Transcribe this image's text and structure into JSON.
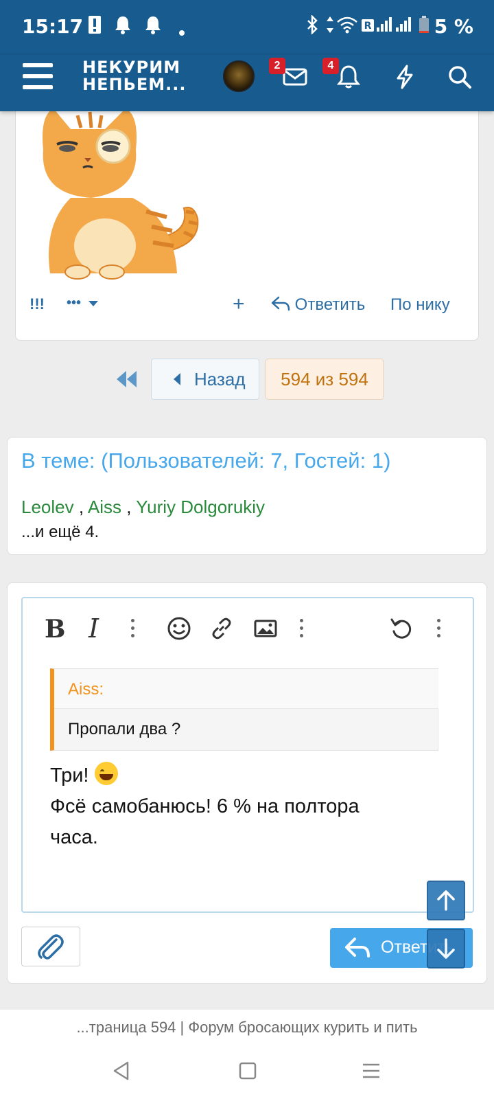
{
  "status_bar": {
    "time": "15:17",
    "battery": "5 %",
    "icons": [
      "alert-icon",
      "bell-icon",
      "bell-icon",
      "dot-icon",
      "bluetooth-icon",
      "data-arrows-icon",
      "wifi-icon",
      "roaming-icon",
      "signal-icon",
      "signal-icon",
      "battery-icon"
    ]
  },
  "header": {
    "logo_line1": "НЕКУРИМ",
    "logo_line2": "НЕПЬЕМ...",
    "messages_badge": "2",
    "alerts_badge": "4"
  },
  "post": {
    "actions": {
      "report": "!!!",
      "more": "•••",
      "add": "+",
      "reply": "Ответить",
      "by_nick": "По нику"
    }
  },
  "pagination": {
    "back": "Назад",
    "current": "594 из 594"
  },
  "online": {
    "title": "В теме: (Пользователей: 7, Гостей: 1)",
    "users": [
      "Leolev",
      "Aiss",
      "Yuriy Dolgorukiy"
    ],
    "separator": " , ",
    "more": "...и ещё 4."
  },
  "editor": {
    "quote_author": "Aiss:",
    "quote_text": "Пропали два ?",
    "message_line1": "Три! ",
    "message_line2": "Фсё самобанюсь! 6 % на полтора",
    "message_line3": "часа.",
    "reply_button": "Ответить"
  },
  "browser": {
    "title": "...траница 594 | Форум бросающих курить и пить"
  },
  "colors": {
    "header_bg": "#185b8e",
    "link": "#2d6ea5",
    "accent_blue": "#47a7eb",
    "user_green": "#2a8a3c",
    "quote_orange": "#f2931e",
    "badge_red": "#d8202a"
  }
}
